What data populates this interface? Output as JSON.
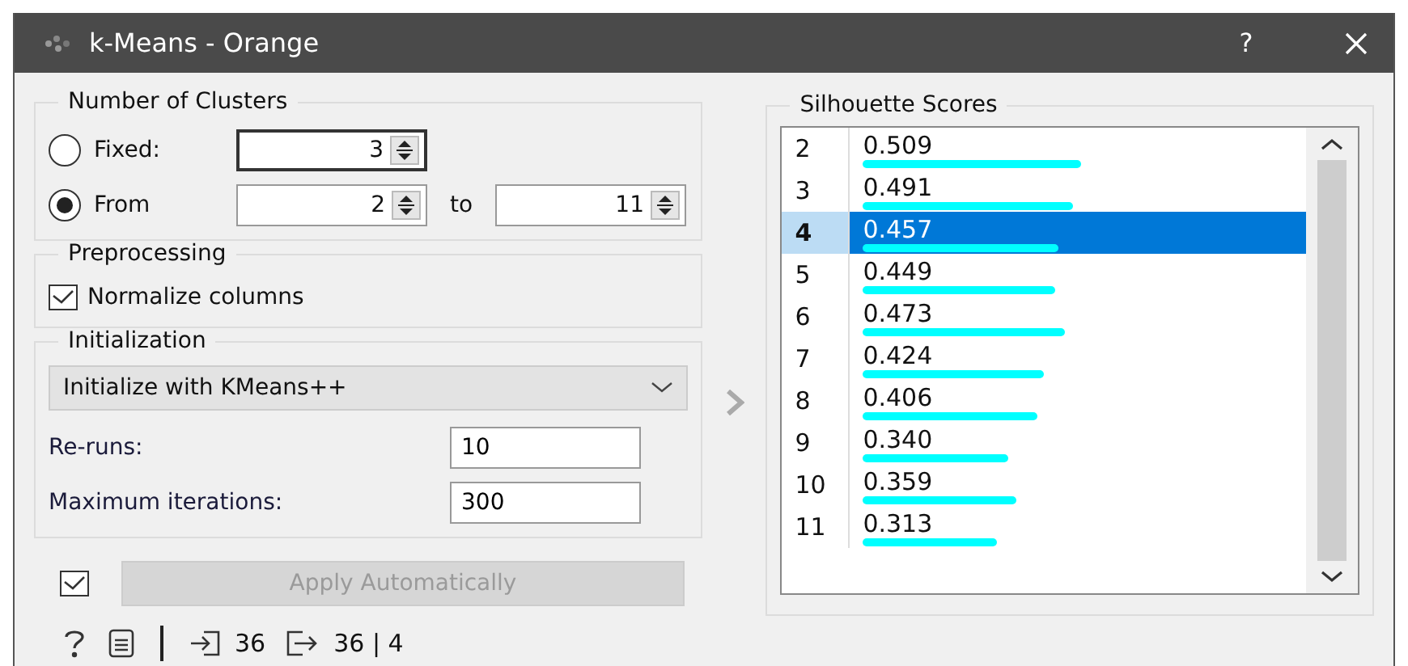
{
  "window": {
    "title": "k-Means - Orange",
    "help": "?"
  },
  "clusters": {
    "title": "Number of Clusters",
    "options": [
      {
        "kind": "fixed",
        "label": "Fixed:",
        "selected": false,
        "value": "3"
      },
      {
        "kind": "range",
        "label": "From",
        "selected": true,
        "value": "2",
        "to_label": "to",
        "to_value": "11"
      }
    ]
  },
  "preprocessing": {
    "title": "Preprocessing",
    "checkbox": {
      "label": "Normalize columns",
      "checked": true
    }
  },
  "initialization": {
    "title": "Initialization",
    "method": "Initialize with KMeans++",
    "fields": [
      {
        "label": "Re-runs:",
        "value": "10"
      },
      {
        "label": "Maximum iterations:",
        "value": "300"
      }
    ]
  },
  "apply": {
    "checked": true,
    "label": "Apply Automatically",
    "disabled": true
  },
  "status": {
    "input": "36",
    "output": "36 | 4"
  },
  "scores": {
    "title": "Silhouette Scores",
    "rows": [
      {
        "k": "2",
        "score": "0.509",
        "selected": false
      },
      {
        "k": "3",
        "score": "0.491",
        "selected": false
      },
      {
        "k": "4",
        "score": "0.457",
        "selected": true
      },
      {
        "k": "5",
        "score": "0.449",
        "selected": false
      },
      {
        "k": "6",
        "score": "0.473",
        "selected": false
      },
      {
        "k": "7",
        "score": "0.424",
        "selected": false
      },
      {
        "k": "8",
        "score": "0.406",
        "selected": false
      },
      {
        "k": "9",
        "score": "0.340",
        "selected": false
      },
      {
        "k": "10",
        "score": "0.359",
        "selected": false
      },
      {
        "k": "11",
        "score": "0.313",
        "selected": false
      }
    ]
  }
}
